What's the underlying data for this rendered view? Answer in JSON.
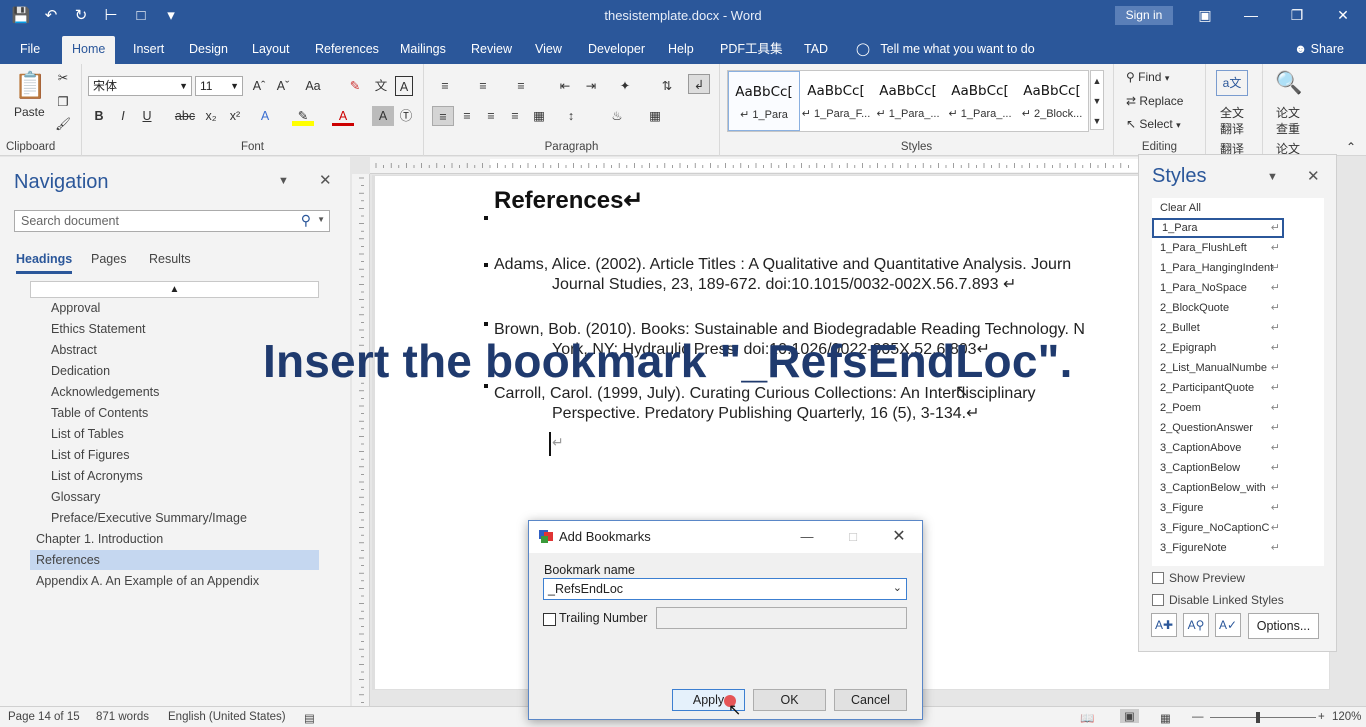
{
  "window": {
    "doc_title": "thesistemplate.docx - Word",
    "signin": "Sign in"
  },
  "menu_tabs": [
    "File",
    "Home",
    "Insert",
    "Design",
    "Layout",
    "References",
    "Mailings",
    "Review",
    "View",
    "Developer",
    "Help",
    "PDF工具集",
    "TAD"
  ],
  "tell_me": "Tell me what you want to do",
  "share": "Share",
  "ribbon": {
    "clipboard_label": "Clipboard",
    "paste_label": "Paste",
    "font_label": "Font",
    "font_name": "宋体",
    "font_size": "11",
    "paragraph_label": "Paragraph",
    "styles_label": "Styles",
    "editing_label": "Editing",
    "find_label": "Find",
    "replace_label": "Replace",
    "select_label": "Select",
    "translate_label_1": "全文",
    "translate_label_2": "翻译",
    "translate_label_3": "翻译",
    "paper_label_1": "论文",
    "paper_label_2": "查重",
    "paper_label_3": "论文",
    "style_tiles": [
      {
        "sample": "AaBbCc[",
        "name": "↵ 1_Para"
      },
      {
        "sample": "AaBbCc[",
        "name": "↵ 1_Para_F..."
      },
      {
        "sample": "AaBbCc[",
        "name": "↵ 1_Para_..."
      },
      {
        "sample": "AaBbCc[",
        "name": "↵ 1_Para_..."
      },
      {
        "sample": "AaBbCc[",
        "name": "↵ 2_Block..."
      }
    ]
  },
  "navigation": {
    "title": "Navigation",
    "search_placeholder": "Search document",
    "tabs": [
      "Headings",
      "Pages",
      "Results"
    ],
    "headings": [
      {
        "text": "Approval",
        "level": 2
      },
      {
        "text": "Ethics Statement",
        "level": 2
      },
      {
        "text": "Abstract",
        "level": 2
      },
      {
        "text": "Dedication",
        "level": 2
      },
      {
        "text": "Acknowledgements",
        "level": 2
      },
      {
        "text": "Table of Contents",
        "level": 2
      },
      {
        "text": "List of Tables",
        "level": 2
      },
      {
        "text": "List of Figures",
        "level": 2
      },
      {
        "text": "List of Acronyms",
        "level": 2
      },
      {
        "text": "Glossary",
        "level": 2
      },
      {
        "text": "Preface/Executive Summary/Image",
        "level": 2
      },
      {
        "text": "Chapter 1.   Introduction",
        "level": 1
      },
      {
        "text": "References",
        "level": 1,
        "selected": true
      },
      {
        "text": "Appendix A.   An Example of an Appendix",
        "level": 1
      }
    ]
  },
  "document": {
    "heading": "References↵",
    "entries": [
      {
        "line1": "Adams, Alice. (2002). Article Titles : A Qualitative and Quantitative Analysis. Journ",
        "line2": "Journal Studies, 23, 189-672. doi:10.1015/0032-002X.56.7.893 ↵"
      },
      {
        "line1": "Brown, Bob. (2010). Books: Sustainable and Biodegradable Reading Technology. N",
        "line2": "York, NY: Hydraulic Press. doi:10.1026/0022-005X.52.6.803↵"
      },
      {
        "line1": "Carroll, Carol. (1999, July). Curating Curious Collections: An Interdisciplinary",
        "line2": "Perspective. Predatory Publishing Quarterly, 16 (5), 3-134.↵"
      }
    ],
    "empty_para": "↵",
    "overlay_caption": "Insert the bookmark \"_RefsEndLoc\"."
  },
  "styles_pane": {
    "title": "Styles",
    "items": [
      "Clear All",
      "1_Para",
      "1_Para_FlushLeft",
      "1_Para_HangingIndent",
      "1_Para_NoSpace",
      "2_BlockQuote",
      "2_Bullet",
      "2_Epigraph",
      "2_List_ManualNumbe",
      "2_ParticipantQuote",
      "2_Poem",
      "2_QuestionAnswer",
      "3_CaptionAbove",
      "3_CaptionBelow",
      "3_CaptionBelow_with",
      "3_Figure",
      "3_Figure_NoCaptionC",
      "3_FigureNote"
    ],
    "selected": "1_Para",
    "show_preview": "Show Preview",
    "disable_linked": "Disable Linked Styles",
    "options": "Options..."
  },
  "dialog": {
    "title": "Add Bookmarks",
    "name_label": "Bookmark name",
    "name_value": "_RefsEndLoc",
    "trailing_label": "Trailing Number",
    "apply": "Apply",
    "ok": "OK",
    "cancel": "Cancel"
  },
  "statusbar": {
    "page": "Page 14 of 15",
    "words": "871 words",
    "language": "English (United States)",
    "zoom": "120%"
  }
}
